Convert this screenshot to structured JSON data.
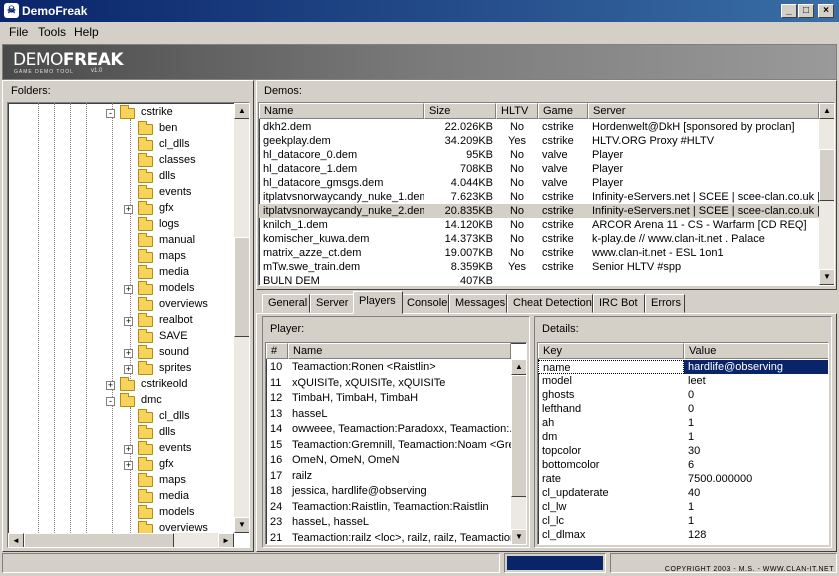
{
  "window": {
    "title": "DemoFreak",
    "icon": "skull-icon",
    "controls": [
      "minimize-icon",
      "maximize-icon",
      "close-icon"
    ]
  },
  "menu": [
    "File",
    "Tools",
    "Help"
  ],
  "logo": {
    "text_light": "DEMO",
    "text_bold": "FREAK",
    "tagline": "GAME DEMO TOOL",
    "version": "v1.0"
  },
  "folders": {
    "label": "Folders:",
    "tree": [
      {
        "label": "cstrike",
        "level": 0,
        "expander": "-"
      },
      {
        "label": "ben",
        "level": 1,
        "expander": ""
      },
      {
        "label": "cl_dlls",
        "level": 1,
        "expander": ""
      },
      {
        "label": "classes",
        "level": 1,
        "expander": ""
      },
      {
        "label": "dlls",
        "level": 1,
        "expander": ""
      },
      {
        "label": "events",
        "level": 1,
        "expander": ""
      },
      {
        "label": "gfx",
        "level": 1,
        "expander": "+"
      },
      {
        "label": "logs",
        "level": 1,
        "expander": ""
      },
      {
        "label": "manual",
        "level": 1,
        "expander": ""
      },
      {
        "label": "maps",
        "level": 1,
        "expander": ""
      },
      {
        "label": "media",
        "level": 1,
        "expander": ""
      },
      {
        "label": "models",
        "level": 1,
        "expander": "+"
      },
      {
        "label": "overviews",
        "level": 1,
        "expander": ""
      },
      {
        "label": "realbot",
        "level": 1,
        "expander": "+"
      },
      {
        "label": "SAVE",
        "level": 1,
        "expander": ""
      },
      {
        "label": "sound",
        "level": 1,
        "expander": "+"
      },
      {
        "label": "sprites",
        "level": 1,
        "expander": "+"
      },
      {
        "label": "cstrikeold",
        "level": 0,
        "expander": "+"
      },
      {
        "label": "dmc",
        "level": 0,
        "expander": "-"
      },
      {
        "label": "cl_dlls",
        "level": 1,
        "expander": ""
      },
      {
        "label": "dlls",
        "level": 1,
        "expander": ""
      },
      {
        "label": "events",
        "level": 1,
        "expander": "+"
      },
      {
        "label": "gfx",
        "level": 1,
        "expander": "+"
      },
      {
        "label": "maps",
        "level": 1,
        "expander": ""
      },
      {
        "label": "media",
        "level": 1,
        "expander": ""
      },
      {
        "label": "models",
        "level": 1,
        "expander": ""
      },
      {
        "label": "overviews",
        "level": 1,
        "expander": ""
      }
    ]
  },
  "demos": {
    "label": "Demos:",
    "columns": [
      "Name",
      "Size",
      "HLTV",
      "Game",
      "Server"
    ],
    "selected_index": 6,
    "rows": [
      [
        "dkh2.dem",
        "22.026KB",
        "No",
        "cstrike",
        "Hordenwelt@DkH [sponsored by proclan]"
      ],
      [
        "geekplay.dem",
        "34.209KB",
        "Yes",
        "cstrike",
        "HLTV.ORG Proxy #HLTV"
      ],
      [
        "hl_datacore_0.dem",
        "95KB",
        "No",
        "valve",
        "Player"
      ],
      [
        "hl_datacore_1.dem",
        "708KB",
        "No",
        "valve",
        "Player"
      ],
      [
        "hl_datacore_gmsgs.dem",
        "4.044KB",
        "No",
        "valve",
        "Player"
      ],
      [
        "itplatvsnorwaycandy_nuke_1.dem",
        "7.623KB",
        "No",
        "cstrike",
        "Infinity-eServers.net | SCEE | scee-clan.co.uk |"
      ],
      [
        "itplatvsnorwaycandy_nuke_2.dem",
        "20.835KB",
        "No",
        "cstrike",
        "Infinity-eServers.net | SCEE | scee-clan.co.uk |"
      ],
      [
        "knilch_1.dem",
        "14.120KB",
        "No",
        "cstrike",
        "ARCOR Arena 11 - CS - Warfarm [CD REQ]"
      ],
      [
        "komischer_kuwa.dem",
        "14.373KB",
        "No",
        "cstrike",
        "k-play.de // www.clan-it.net . Palace"
      ],
      [
        "matrix_azze_ct.dem",
        "19.007KB",
        "No",
        "cstrike",
        "www.clan-it.net - ESL 1on1"
      ],
      [
        "mTw.swe_train.dem",
        "8.359KB",
        "Yes",
        "cstrike",
        "Senior HLTV #spp"
      ],
      [
        "BULN DEM",
        "407KB",
        "",
        "",
        ""
      ]
    ]
  },
  "tabs": [
    "General",
    "Server",
    "Players",
    "Console",
    "Messages",
    "Cheat Detection",
    "IRC Bot",
    "Errors"
  ],
  "active_tab": "Players",
  "players": {
    "label": "Player:",
    "columns": [
      "#",
      "Name"
    ],
    "rows": [
      [
        "10",
        "Teamaction:Ronen <Raistlin>"
      ],
      [
        "11",
        "xQUISITe, xQUISITe, xQUISITe"
      ],
      [
        "12",
        "TimbaH, TimbaH, TimbaH"
      ],
      [
        "13",
        "hasseL"
      ],
      [
        "14",
        "owweee, Teamaction:Paradoxx, Teamaction:..."
      ],
      [
        "15",
        "Teamaction:Gremnill, Teamaction:Noam <Gre..."
      ],
      [
        "16",
        "OmeN, OmeN, OmeN"
      ],
      [
        "17",
        "railz"
      ],
      [
        "18",
        "jessica, hardlife@observing"
      ],
      [
        "24",
        "Teamaction:Raistlin, Teamaction:Raistlin"
      ],
      [
        "23",
        "hasseL, hasseL"
      ],
      [
        "21",
        "Teamaction:railz <loc>, railz, railz, Teamaction:..."
      ]
    ]
  },
  "details": {
    "label": "Details:",
    "columns": [
      "Key",
      "Value"
    ],
    "selected_index": 0,
    "rows": [
      [
        "name",
        "hardlife@observing"
      ],
      [
        "model",
        "leet"
      ],
      [
        "ghosts",
        "0"
      ],
      [
        "lefthand",
        "0"
      ],
      [
        "ah",
        "1"
      ],
      [
        "dm",
        "1"
      ],
      [
        "topcolor",
        "30"
      ],
      [
        "bottomcolor",
        "6"
      ],
      [
        "rate",
        "7500.000000"
      ],
      [
        "cl_updaterate",
        "40"
      ],
      [
        "cl_lw",
        "1"
      ],
      [
        "cl_lc",
        "1"
      ],
      [
        "cl_dlmax",
        "128"
      ]
    ]
  },
  "status": {
    "copyright": "COPYRIGHT 2003 - M.S. - WWW.CLAN-IT.NET"
  },
  "colors": {
    "selection": "#0a246a",
    "progress": "#0a246a",
    "face": "#d4d0c8"
  }
}
